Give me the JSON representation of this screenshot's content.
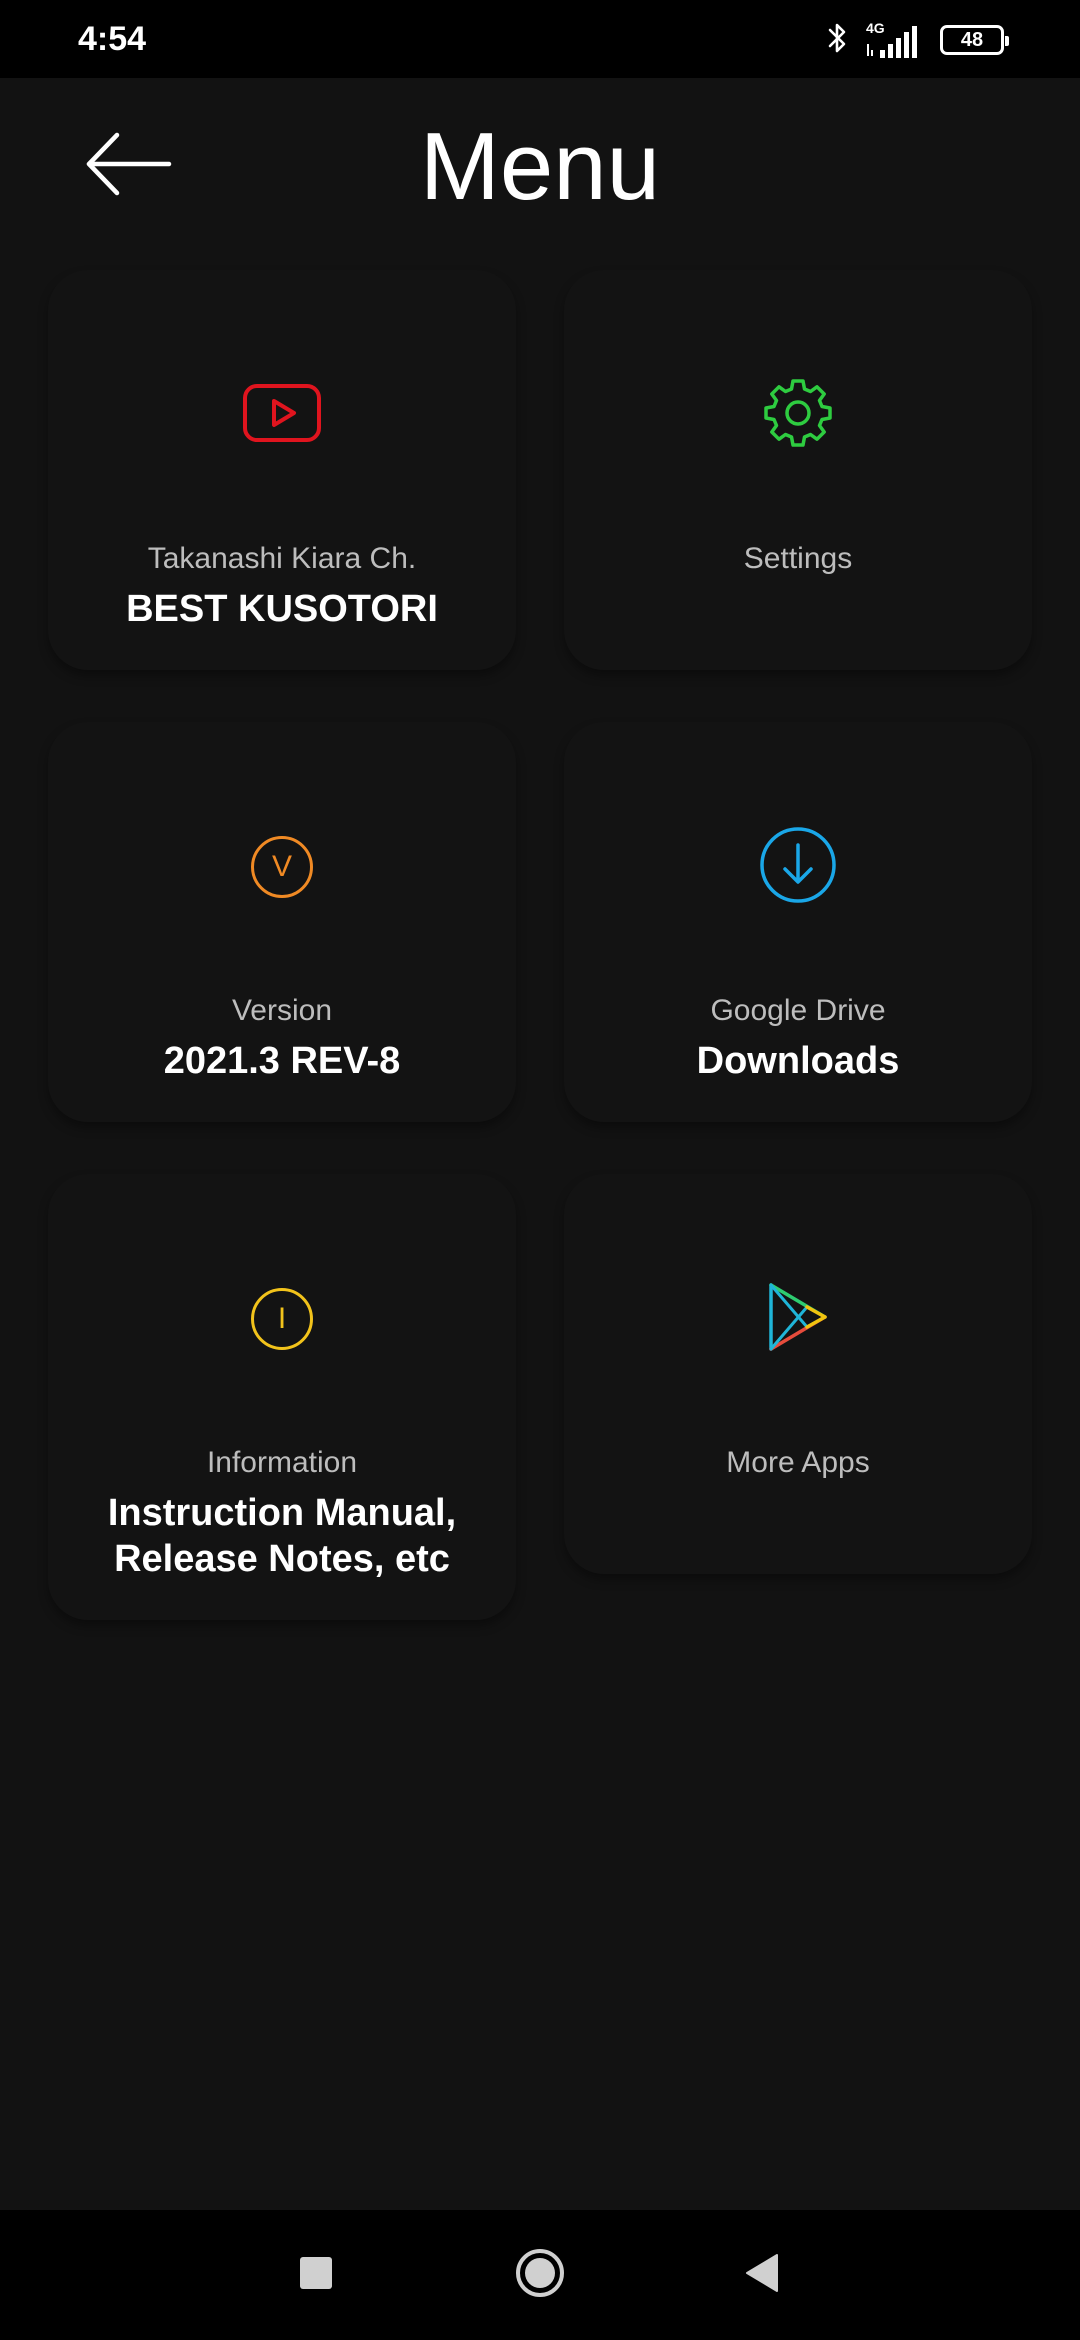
{
  "status_bar": {
    "time": "4:54",
    "network": "4G",
    "battery": "48"
  },
  "header": {
    "title": "Menu"
  },
  "cards": {
    "channel": {
      "subtitle": "Takanashi Kiara Ch.",
      "value": "BEST KUSOTORI",
      "icon": "youtube-play-icon",
      "color": "#e0141e"
    },
    "settings": {
      "title": "Settings",
      "icon": "gear-icon",
      "color": "#2ecc40"
    },
    "version": {
      "subtitle": "Version",
      "value": "2021.3 REV-8",
      "icon_letter": "V",
      "icon": "version-icon",
      "color": "#f08a24"
    },
    "drive": {
      "subtitle": "Google Drive",
      "value": "Downloads",
      "icon": "download-icon",
      "color": "#1aa7e8"
    },
    "info": {
      "subtitle": "Information",
      "value_line1": "Instruction Manual,",
      "value_line2": "Release Notes, etc",
      "icon_letter": "I",
      "icon": "info-icon",
      "color": "#f2c31b"
    },
    "more_apps": {
      "title": "More Apps",
      "icon": "play-store-icon"
    }
  },
  "nav": {
    "recents": "recents-icon",
    "home": "home-icon",
    "back": "back-triangle-icon"
  }
}
